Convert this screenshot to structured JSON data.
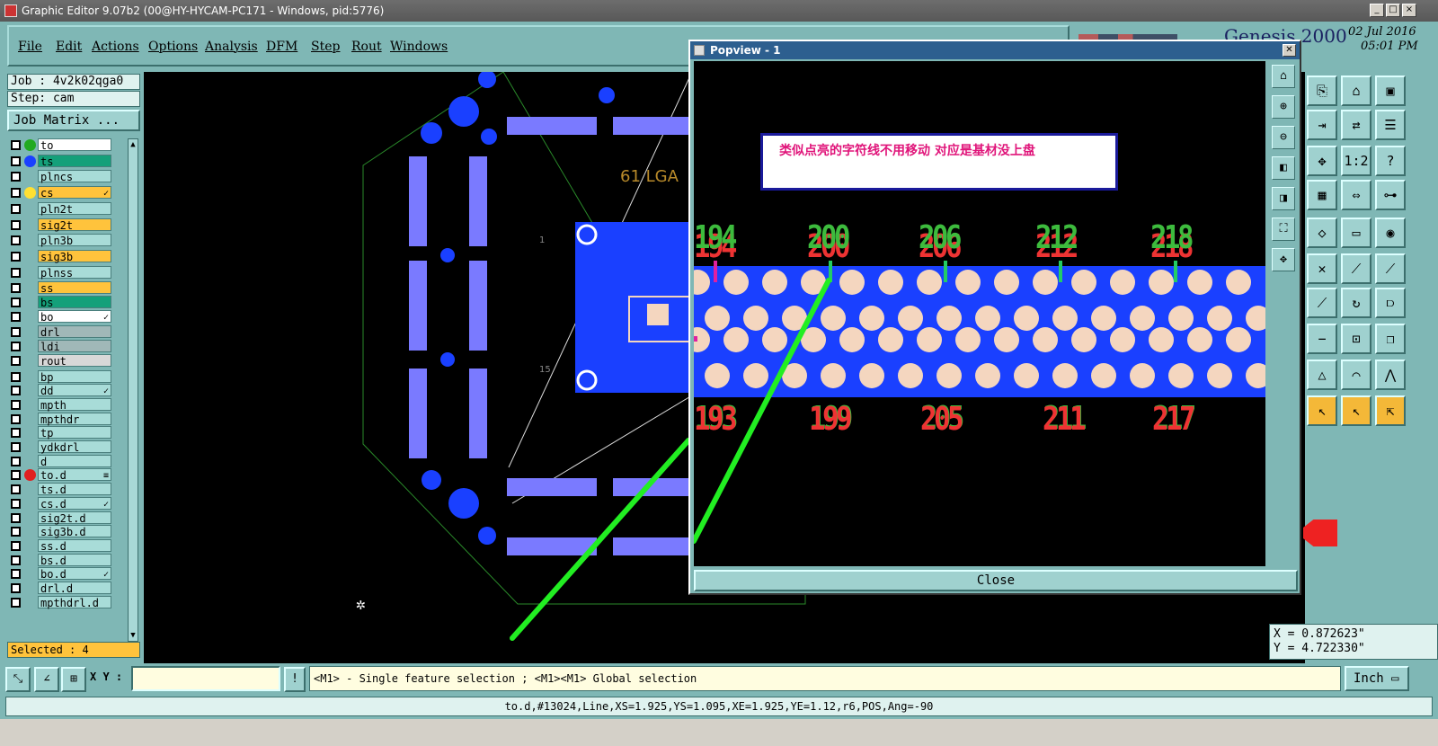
{
  "window": {
    "title": "Graphic Editor 9.07b2 (00@HY-HYCAM-PC171 - Windows, pid:5776)",
    "min": "_",
    "max": "□",
    "close": "×"
  },
  "menu": [
    "File",
    "Edit",
    "Actions",
    "Options",
    "Analysis",
    "DFM",
    "Step",
    "Rout",
    "Windows"
  ],
  "genesis": {
    "logo": "Genesis 2000",
    "date": "02 Jul 2016",
    "time": "05:01 PM"
  },
  "job": {
    "job_line": "Job : 4v2k02qga0",
    "step_line": "Step: cam",
    "matrix_label": "Job Matrix ..."
  },
  "layers": [
    {
      "name": "to",
      "bg": "#ffffff",
      "dot": "#22aa22",
      "mark": ""
    },
    {
      "name": "ts",
      "bg": "#14a07a",
      "dot": "#1a40ff",
      "mark": ""
    },
    {
      "name": "plncs",
      "bg": "#a8dcd8",
      "dot": "",
      "mark": ""
    },
    {
      "name": "cs",
      "bg": "#ffc33c",
      "dot": "#ffe032",
      "mark": "✓"
    },
    {
      "name": "pln2t",
      "bg": "#a8dcd8",
      "dot": "",
      "mark": ""
    },
    {
      "name": "sig2t",
      "bg": "#ffc33c",
      "dot": "",
      "mark": ""
    },
    {
      "name": "pln3b",
      "bg": "#a8dcd8",
      "dot": "",
      "mark": ""
    },
    {
      "name": "sig3b",
      "bg": "#ffc33c",
      "dot": "",
      "mark": ""
    },
    {
      "name": "plnss",
      "bg": "#a8dcd8",
      "dot": "",
      "mark": ""
    },
    {
      "name": "ss",
      "bg": "#ffc33c",
      "dot": "",
      "mark": ""
    },
    {
      "name": "bs",
      "bg": "#14a07a",
      "dot": "",
      "mark": ""
    },
    {
      "name": "bo",
      "bg": "#ffffff",
      "dot": "",
      "mark": "✓"
    },
    {
      "name": "drl",
      "bg": "#a0b8b8",
      "dot": "",
      "mark": ""
    },
    {
      "name": "ldi",
      "bg": "#a0b8b8",
      "dot": "",
      "mark": ""
    },
    {
      "name": "rout",
      "bg": "#d8d8d8",
      "dot": "",
      "mark": ""
    },
    {
      "name": "bp",
      "bg": "#a8dcd8",
      "dot": "",
      "mark": ""
    },
    {
      "name": "dd",
      "bg": "#a8dcd8",
      "dot": "",
      "mark": "✓"
    },
    {
      "name": "mpth",
      "bg": "#a8dcd8",
      "dot": "",
      "mark": ""
    },
    {
      "name": "mpthdr",
      "bg": "#a8dcd8",
      "dot": "",
      "mark": ""
    },
    {
      "name": "tp",
      "bg": "#a8dcd8",
      "dot": "",
      "mark": ""
    },
    {
      "name": "ydkdrl",
      "bg": "#a8dcd8",
      "dot": "",
      "mark": ""
    },
    {
      "name": "d",
      "bg": "#a8dcd8",
      "dot": "",
      "mark": ""
    },
    {
      "name": "to.d",
      "bg": "#a8dcd8",
      "dot": "#e02020",
      "mark": "≡"
    },
    {
      "name": "ts.d",
      "bg": "#a8dcd8",
      "dot": "",
      "mark": ""
    },
    {
      "name": "cs.d",
      "bg": "#a8dcd8",
      "dot": "",
      "mark": "✓"
    },
    {
      "name": "sig2t.d",
      "bg": "#a8dcd8",
      "dot": "",
      "mark": ""
    },
    {
      "name": "sig3b.d",
      "bg": "#a8dcd8",
      "dot": "",
      "mark": ""
    },
    {
      "name": "ss.d",
      "bg": "#a8dcd8",
      "dot": "",
      "mark": ""
    },
    {
      "name": "bs.d",
      "bg": "#a8dcd8",
      "dot": "",
      "mark": ""
    },
    {
      "name": "bo.d",
      "bg": "#a8dcd8",
      "dot": "",
      "mark": "✓"
    },
    {
      "name": "drl.d",
      "bg": "#a8dcd8",
      "dot": "",
      "mark": ""
    },
    {
      "name": "mpthdrl.d",
      "bg": "#a8dcd8",
      "dot": "",
      "mark": ""
    }
  ],
  "selected": "Selected : 4",
  "canvas_labels": {
    "lga": "61 LGA",
    "one": "1",
    "fifteen": "15"
  },
  "popview": {
    "title": "Popview - 1",
    "note": "类似点亮的字符线不用移动    对应是基材没上盘",
    "top_numbers": [
      "194",
      "200",
      "206",
      "212",
      "218"
    ],
    "bottom_numbers": [
      "193",
      "199",
      "205",
      "211",
      "217"
    ],
    "close_label": "Close"
  },
  "coords": {
    "x": "X = 0.872623\"",
    "y": "Y = 4.722330\""
  },
  "bottom": {
    "xy_label": "X Y :",
    "xy_value": "",
    "hint": "<M1> - Single feature selection ; <M1><M1> Global selection",
    "unit": "Inch"
  },
  "status": "to.d,#13024,Line,XS=1.925,YS=1.095,XE=1.925,YE=1.12,r6,POS,Ang=-90",
  "colors": {
    "panel": "#7fb7b5",
    "canvas": "#000000",
    "board": "#1a40ff",
    "pad": "#f4d6bf",
    "arrow": "#22ee22"
  }
}
